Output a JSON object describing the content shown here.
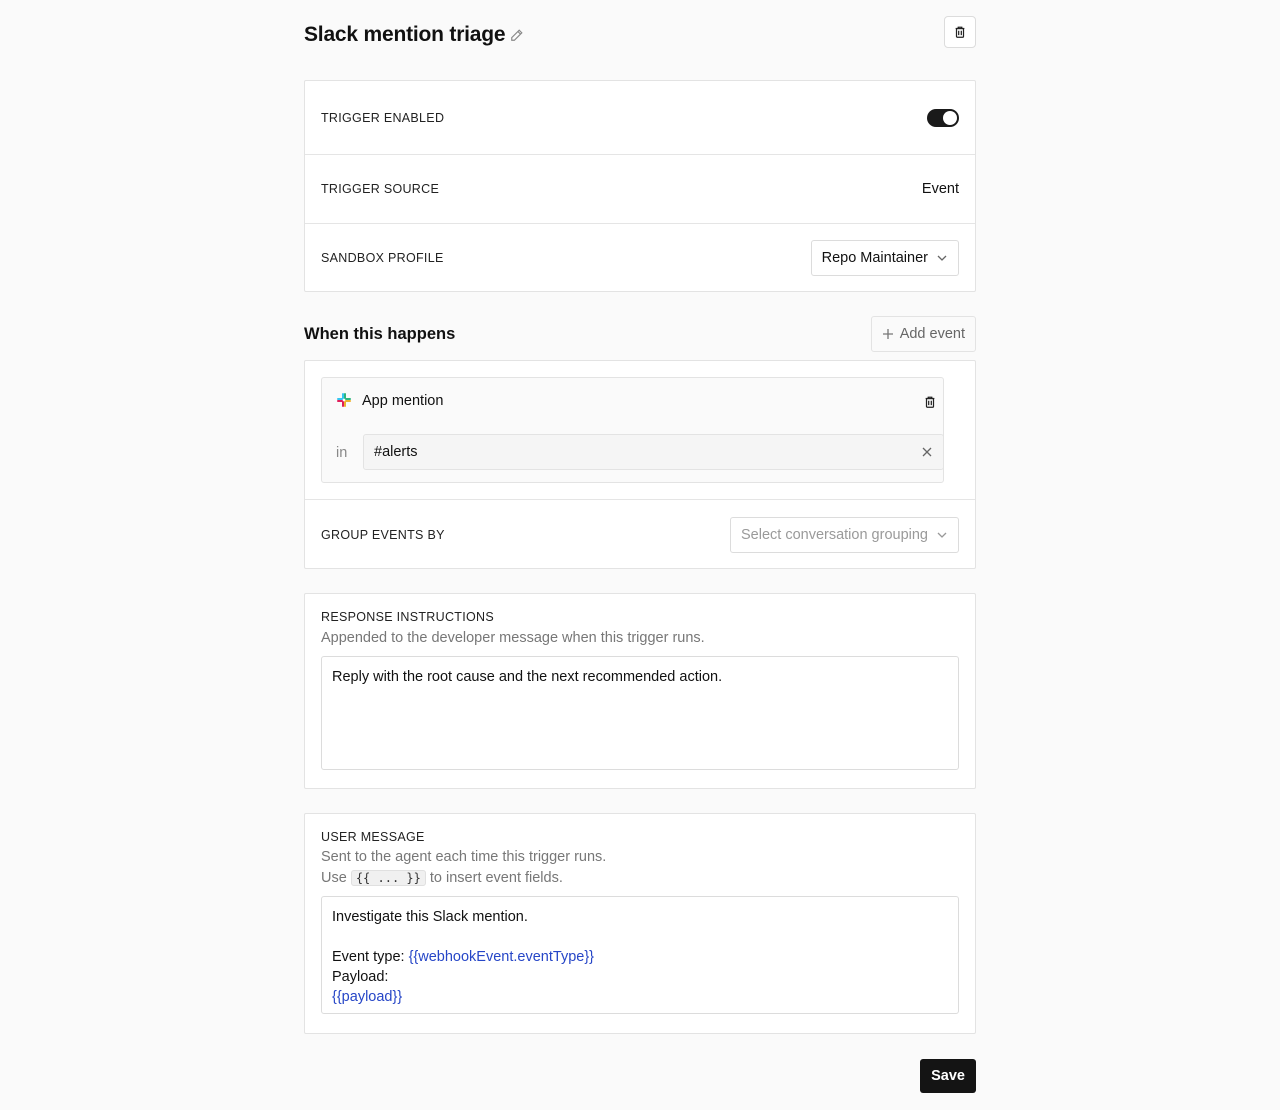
{
  "header": {
    "title": "Slack mention triage"
  },
  "settings": {
    "trigger_enabled": {
      "label": "TRIGGER ENABLED",
      "enabled": true
    },
    "trigger_source": {
      "label": "TRIGGER SOURCE",
      "value": "Event"
    },
    "sandbox_profile": {
      "label": "SANDBOX PROFILE",
      "value": "Repo Maintainer"
    }
  },
  "events_section": {
    "title": "When this happens",
    "add_label": "Add event",
    "items": [
      {
        "name": "App mention",
        "in_label": "in",
        "channel": "#alerts"
      }
    ],
    "group_by": {
      "label": "GROUP EVENTS BY",
      "placeholder": "Select conversation grouping"
    }
  },
  "response_instructions": {
    "label": "RESPONSE INSTRUCTIONS",
    "description": "Appended to the developer message when this trigger runs.",
    "value": "Reply with the root cause and the next recommended action."
  },
  "user_message": {
    "label": "USER MESSAGE",
    "description_line1": "Sent to the agent each time this trigger runs.",
    "use_prefix": "Use",
    "code": "{{ ... }}",
    "use_suffix": "to insert event fields.",
    "line1": "Investigate this Slack mention.",
    "line2_prefix": "Event type: ",
    "line2_var": "{{webhookEvent.eventType}}",
    "line3": "Payload:",
    "line4_var": "{{payload}}"
  },
  "save_label": "Save",
  "colors": {
    "accent_dark": "#141414",
    "template_var": "#2646c7"
  }
}
